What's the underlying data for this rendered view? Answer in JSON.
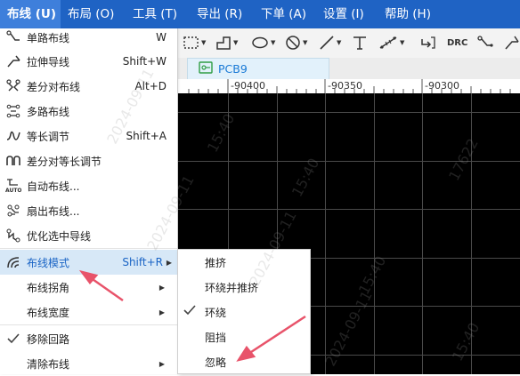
{
  "menubar": {
    "items": [
      {
        "label": "布线 (U)",
        "active": true
      },
      {
        "label": "布局 (O)"
      },
      {
        "label": "工具 (T)"
      },
      {
        "label": "导出 (R)"
      },
      {
        "label": "下单 (A)"
      },
      {
        "label": "设置 (I)"
      },
      {
        "label": "帮助 (H)"
      }
    ]
  },
  "toolbar": {
    "drc_label": "DRC"
  },
  "tab": {
    "label": "PCB9"
  },
  "ruler": {
    "labels": [
      "-90400",
      "-90350",
      "-90300"
    ]
  },
  "route_menu": {
    "items": [
      {
        "label": "单路布线",
        "shortcut": "W",
        "icon": "single-route-icon"
      },
      {
        "label": "拉伸导线",
        "shortcut": "Shift+W",
        "icon": "stretch-trace-icon"
      },
      {
        "label": "差分对布线",
        "shortcut": "Alt+D",
        "icon": "diff-pair-icon"
      },
      {
        "label": "多路布线",
        "shortcut": "",
        "icon": "multi-route-icon"
      },
      {
        "label": "等长调节",
        "shortcut": "Shift+A",
        "icon": "length-tune-icon"
      },
      {
        "label": "差分对等长调节",
        "shortcut": "",
        "icon": "diff-length-tune-icon"
      },
      {
        "label": "自动布线...",
        "shortcut": "",
        "icon": "auto-route-icon"
      },
      {
        "label": "扇出布线...",
        "shortcut": "",
        "icon": "fanout-icon"
      },
      {
        "label": "优化选中导线",
        "shortcut": "",
        "icon": "optimize-trace-icon"
      },
      {
        "label": "布线模式",
        "shortcut": "Shift+R",
        "icon": "route-mode-icon"
      },
      {
        "label": "布线拐角",
        "shortcut": "",
        "icon": ""
      },
      {
        "label": "布线宽度",
        "shortcut": "",
        "icon": ""
      },
      {
        "label": "移除回路",
        "shortcut": "",
        "icon": "check-icon"
      },
      {
        "label": "清除布线",
        "shortcut": "",
        "icon": ""
      }
    ]
  },
  "route_mode_submenu": {
    "items": [
      {
        "label": "推挤",
        "checked": false
      },
      {
        "label": "环绕并推挤",
        "checked": false
      },
      {
        "label": "环绕",
        "checked": true
      },
      {
        "label": "阻挡",
        "checked": false
      },
      {
        "label": "忽略",
        "checked": false
      }
    ]
  },
  "watermark": {
    "texts": [
      "2024-09-11",
      "15:40",
      "17622"
    ]
  },
  "colors": {
    "menubar": "#1f63c4",
    "highlight": "#d7e8f7",
    "canvas": "#000000",
    "arrow": "#e8536a"
  }
}
